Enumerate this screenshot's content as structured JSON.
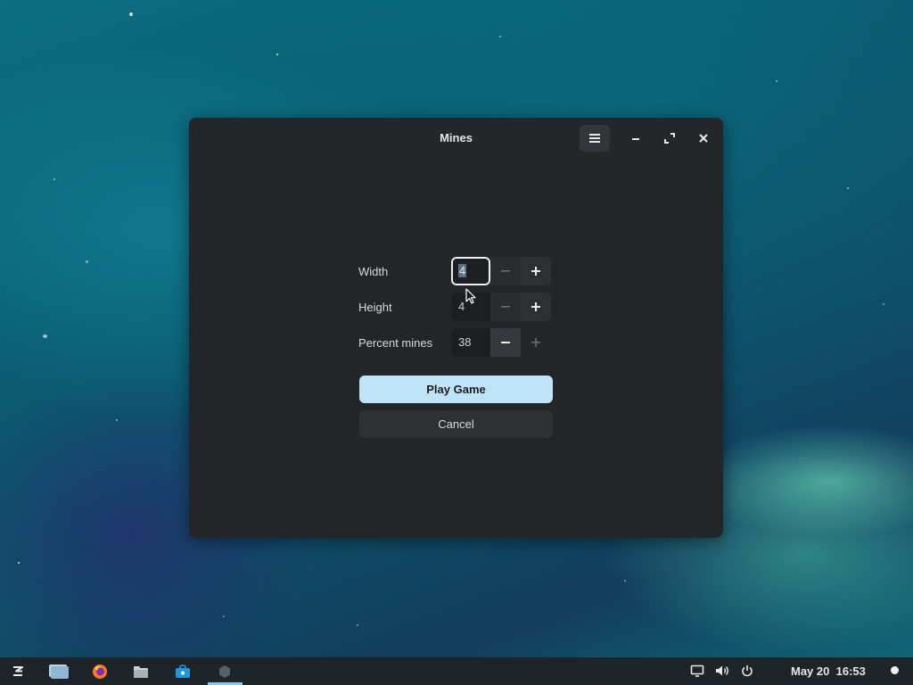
{
  "window": {
    "title": "Mines",
    "menu_icon": "hamburger-menu-icon",
    "minimize_icon": "minimize-icon",
    "maximize_icon": "maximize-icon",
    "close_icon": "close-icon"
  },
  "form": {
    "width": {
      "label": "Width",
      "value": "4"
    },
    "height": {
      "label": "Height",
      "value": "4"
    },
    "percent_mines": {
      "label": "Percent mines",
      "value": "38"
    },
    "play_button": "Play Game",
    "cancel_button": "Cancel"
  },
  "taskbar": {
    "apps": [
      "zorin-menu-icon",
      "files-window-icon",
      "firefox-icon",
      "files-folder-icon",
      "software-store-icon",
      "mines-app-icon"
    ],
    "tray": [
      "screen-icon",
      "volume-icon",
      "power-icon"
    ],
    "date": "May 20",
    "time": "16:53"
  },
  "colors": {
    "accent": "#bfe3f7",
    "window_bg": "#232629",
    "taskbar_bg": "#1e2427"
  }
}
